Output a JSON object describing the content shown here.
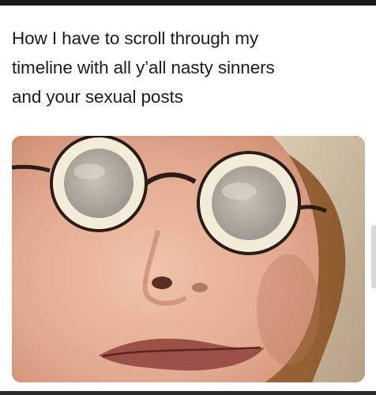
{
  "post": {
    "caption_lines": [
      "How I have to scroll through my",
      "timeline with all y’all nasty sinners",
      "and your sexual posts"
    ]
  },
  "photo": {
    "subject": "close-up-face-with-round-glasses"
  },
  "colors": {
    "background": "#ffffff",
    "text": "#1c1c1c",
    "skin": "#e7b49c",
    "lens_rim": "#f2ecd8",
    "frame": "#3a2a22"
  }
}
